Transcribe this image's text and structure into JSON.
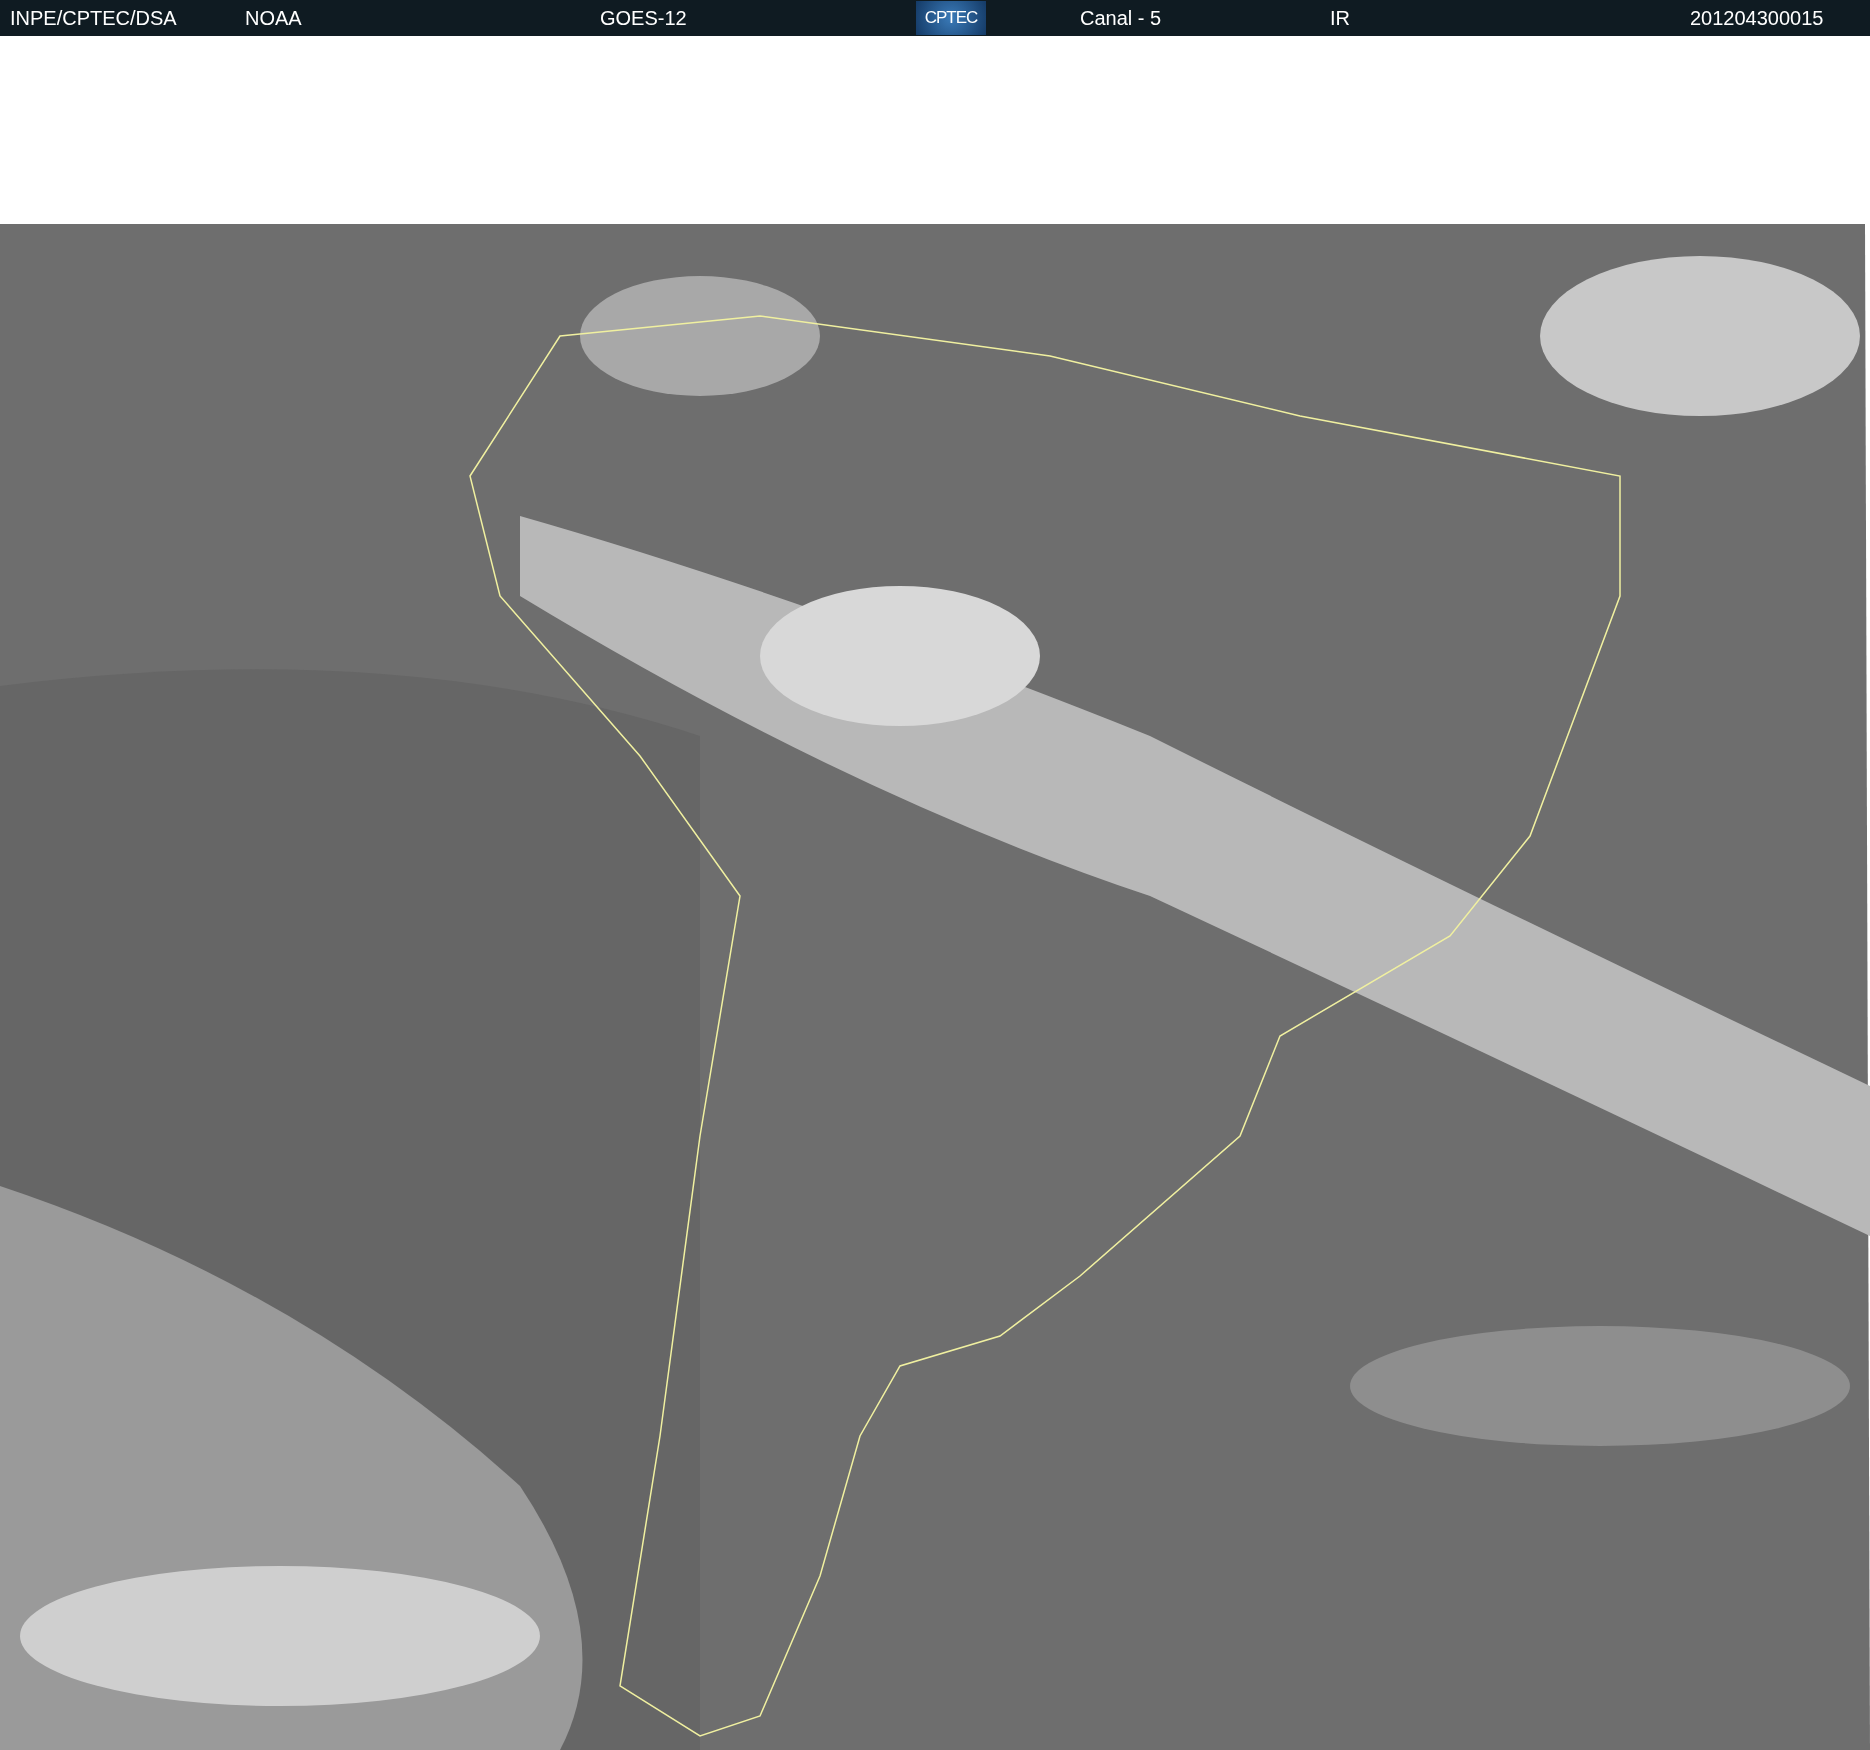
{
  "header": {
    "items": [
      {
        "kind": "text",
        "text": "INPE/CPTEC/DSA"
      },
      {
        "kind": "text",
        "text": "NOAA"
      },
      {
        "kind": "text",
        "text": "GOES-12"
      },
      {
        "kind": "logo",
        "text": "CPTEC"
      },
      {
        "kind": "text",
        "text": "Canal - 5"
      },
      {
        "kind": "text",
        "text": "IR"
      },
      {
        "kind": "text",
        "text": "201204300015"
      }
    ]
  }
}
